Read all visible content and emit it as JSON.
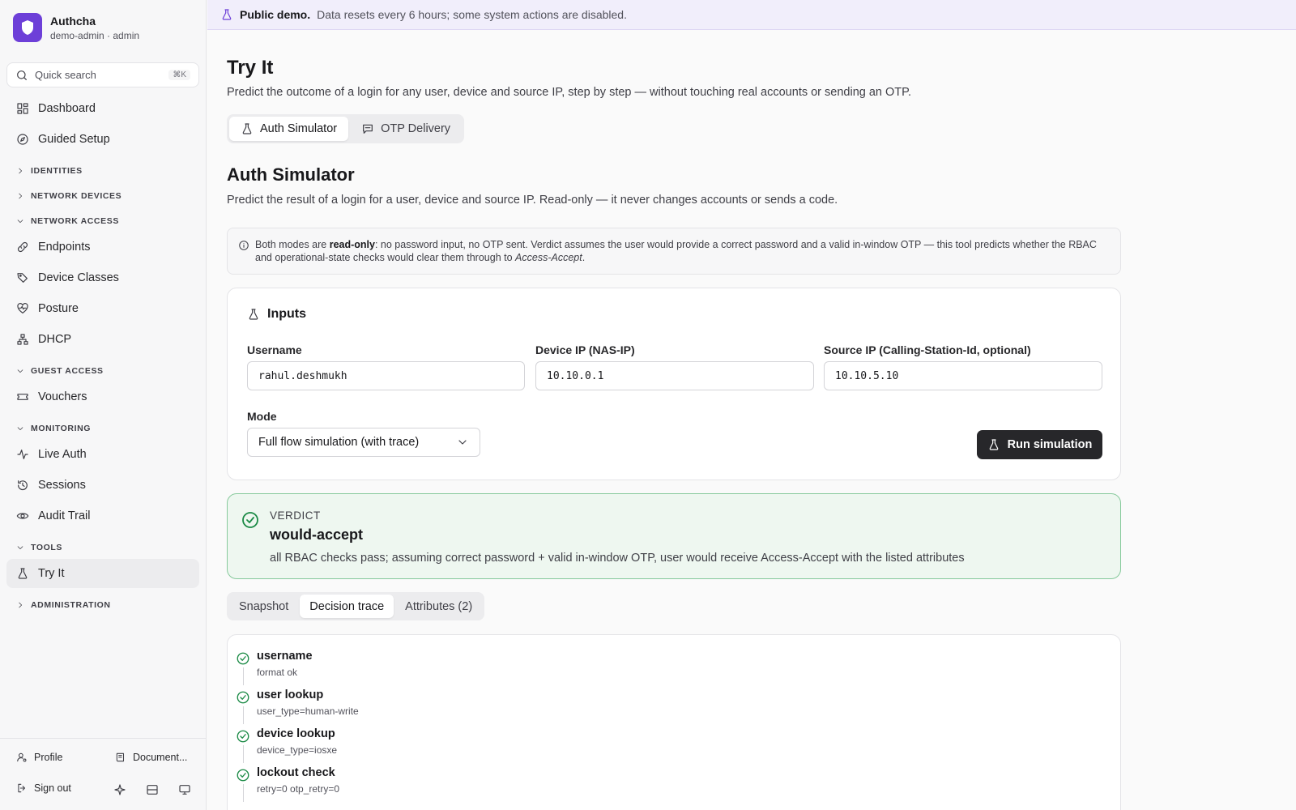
{
  "app": {
    "name": "Authcha",
    "user": "demo-admin · admin"
  },
  "search": {
    "placeholder": "Quick search",
    "shortcut": "⌘K"
  },
  "sidebar": {
    "top_items": [
      {
        "label": "Dashboard",
        "icon": "dashboard-icon"
      },
      {
        "label": "Guided Setup",
        "icon": "compass-icon"
      }
    ],
    "sections": {
      "identities": "IDENTITIES",
      "network_devices": "NETWORK DEVICES",
      "network_access": "NETWORK ACCESS",
      "guest_access": "GUEST ACCESS",
      "monitoring": "MONITORING",
      "tools": "TOOLS",
      "administration": "ADMINISTRATION"
    },
    "network_access_items": [
      "Endpoints",
      "Device Classes",
      "Posture",
      "DHCP"
    ],
    "guest_access_items": [
      "Vouchers"
    ],
    "monitoring_items": [
      "Live Auth",
      "Sessions",
      "Audit Trail"
    ],
    "tools_items": [
      "Try It"
    ],
    "footer": {
      "profile": "Profile",
      "docs": "Document...",
      "sign_out": "Sign out"
    }
  },
  "banner": {
    "strong": "Public demo.",
    "text": "Data resets every 6 hours; some system actions are disabled."
  },
  "page": {
    "title": "Try It",
    "description": "Predict the outcome of a login for any user, device and source IP, step by step — without touching real accounts or sending an OTP.",
    "tabs": [
      "Auth Simulator",
      "OTP Delivery"
    ]
  },
  "simulator": {
    "title": "Auth Simulator",
    "description": "Predict the result of a login for a user, device and source IP. Read-only — it never changes accounts or sends a code.",
    "note": {
      "prefix": "Both modes are ",
      "strong": "read-only",
      "middle": ": no password input, no OTP sent. Verdict assumes the user would provide a correct password and a valid in-window OTP — this tool predicts whether the RBAC and operational-state checks would clear them through to ",
      "em": "Access-Accept",
      "suffix": "."
    },
    "inputs": {
      "title": "Inputs",
      "username_label": "Username",
      "username_value": "rahul.deshmukh",
      "device_ip_label": "Device IP (NAS-IP)",
      "device_ip_value": "10.10.0.1",
      "source_ip_label": "Source IP (Calling-Station-Id, optional)",
      "source_ip_value": "10.10.5.10",
      "mode_label": "Mode",
      "mode_value": "Full flow simulation (with trace)",
      "run_label": "Run simulation"
    },
    "verdict": {
      "kicker": "VERDICT",
      "title": "would-accept",
      "description": "all RBAC checks pass; assuming correct password + valid in-window OTP, user would receive Access-Accept with the listed attributes"
    },
    "result_tabs": [
      "Snapshot",
      "Decision trace",
      "Attributes (2)"
    ],
    "trace": [
      {
        "name": "username",
        "detail": "format ok"
      },
      {
        "name": "user lookup",
        "detail": "user_type=human-write"
      },
      {
        "name": "device lookup",
        "detail": "device_type=iosxe"
      },
      {
        "name": "lockout check",
        "detail": "retry=0 otp_retry=0"
      }
    ]
  },
  "colors": {
    "accent": "#6d3fd8",
    "success": "#1a8a45",
    "primary_button": "#27272a"
  }
}
